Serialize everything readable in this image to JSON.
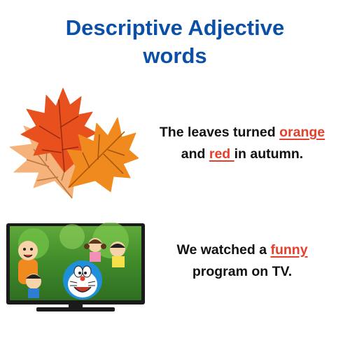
{
  "title": {
    "line1": "Descriptive Adjective",
    "line2": "words"
  },
  "examples": [
    {
      "image": "autumn-leaves-illustration",
      "before": "The leaves turned ",
      "adjective1": "orange",
      "middle": "and ",
      "adjective2": "red ",
      "after": "in autumn."
    },
    {
      "image": "cartoon-tv-illustration",
      "before": "We watched a ",
      "adjective": "funny",
      "after": "program on TV."
    }
  ],
  "colors": {
    "title": "#0b4fa6",
    "highlight": "#e5402b",
    "text": "#111111",
    "leaf_red": "#e8501e",
    "leaf_orange": "#f08a1e",
    "leaf_peach": "#f5b27a"
  }
}
